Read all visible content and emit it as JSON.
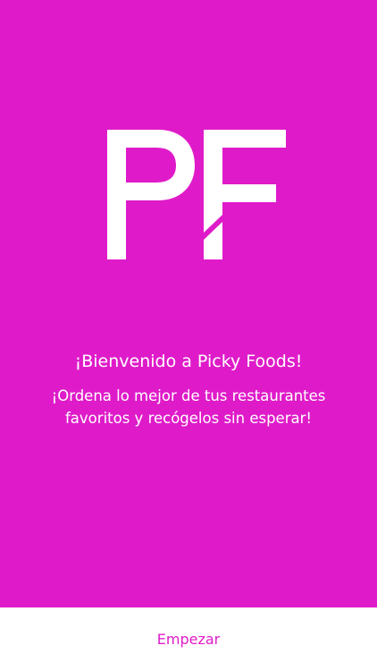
{
  "colors": {
    "brand": "#df1bc9",
    "text_on_brand": "#ffffff",
    "footer_background": "#ffffff"
  },
  "logo": {
    "text": "PF",
    "icon": "picky-foods-logo"
  },
  "welcome": {
    "title": "¡Bienvenido a Picky Foods!",
    "subtitle_line1": "¡Ordena lo mejor de tus restaurantes",
    "subtitle_line2": "favoritos y recógelos sin esperar!"
  },
  "footer": {
    "start_label": "Empezar"
  }
}
